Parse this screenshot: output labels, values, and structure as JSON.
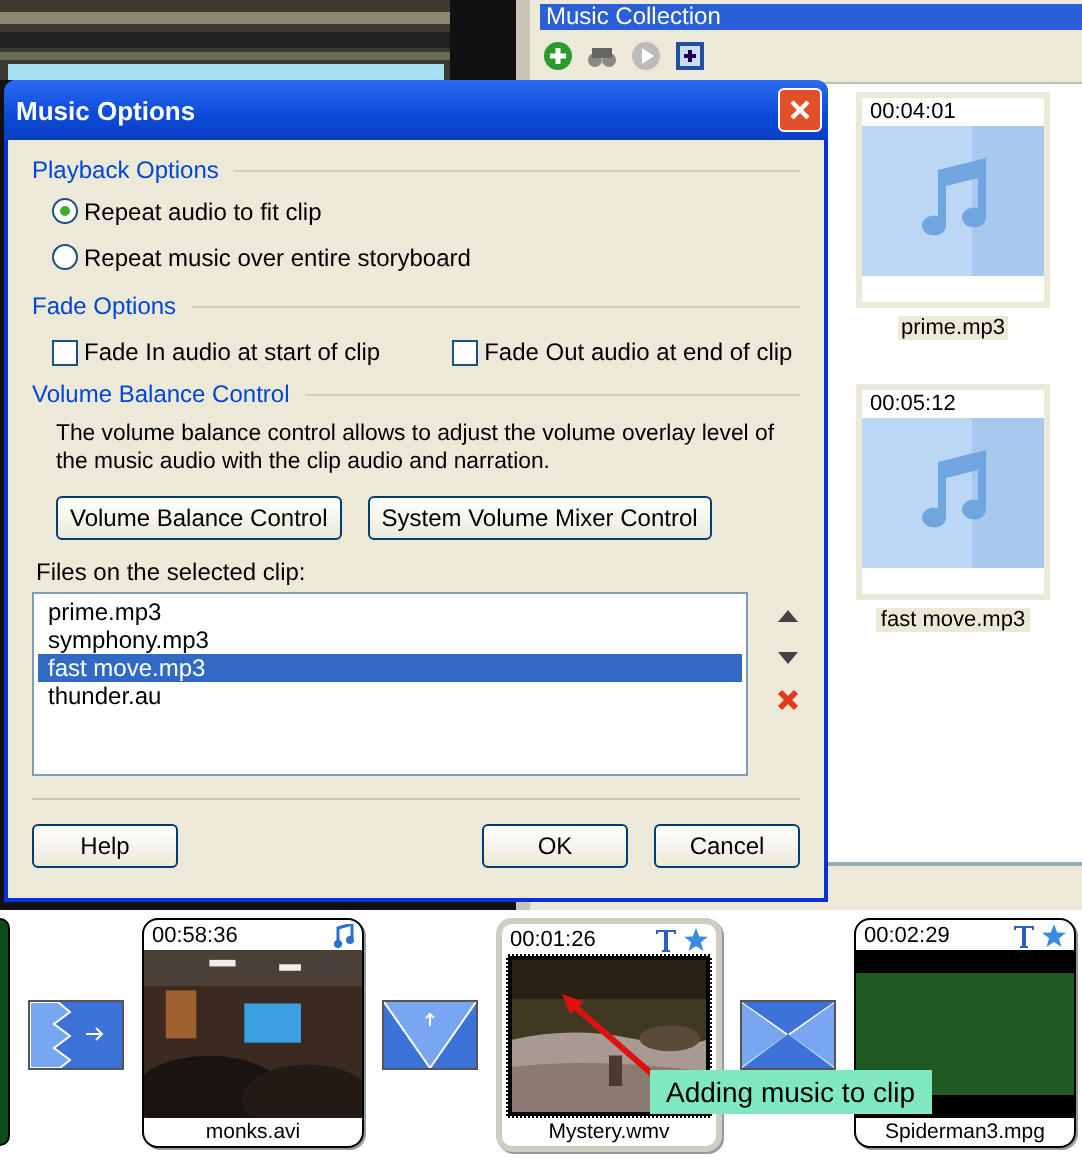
{
  "music_collection": {
    "title": "Music Collection",
    "items": [
      {
        "duration": "00:04:01",
        "name": "prime.mp3"
      },
      {
        "duration": "00:05:12",
        "name": "fast move.mp3"
      }
    ]
  },
  "dialog": {
    "title": "Music Options",
    "playback": {
      "heading": "Playback Options",
      "options": [
        {
          "label": "Repeat audio to fit clip",
          "selected": true
        },
        {
          "label": "Repeat music over entire storyboard",
          "selected": false
        }
      ]
    },
    "fade": {
      "heading": "Fade Options",
      "options": [
        {
          "label": "Fade In audio at start of clip",
          "checked": false
        },
        {
          "label": "Fade Out audio at end of clip",
          "checked": false
        }
      ]
    },
    "volume": {
      "heading": "Volume Balance Control",
      "description": "The volume balance control allows to adjust the volume overlay level of the music audio with the clip audio and narration.",
      "buttons": [
        "Volume Balance Control",
        "System Volume Mixer Control"
      ]
    },
    "files": {
      "label": "Files on the selected clip:",
      "items": [
        {
          "name": "prime.mp3",
          "selected": false
        },
        {
          "name": "symphony.mp3",
          "selected": false
        },
        {
          "name": "fast move.mp3",
          "selected": true
        },
        {
          "name": "thunder.au",
          "selected": false
        }
      ]
    },
    "buttons": {
      "help": "Help",
      "ok": "OK",
      "cancel": "Cancel"
    }
  },
  "storyboard": {
    "clips": [
      {
        "duration": "00:58:36",
        "name": "monks.avi",
        "selected": false,
        "music": true,
        "title": false,
        "effect": false
      },
      {
        "duration": "00:01:26",
        "name": "Mystery.wmv",
        "selected": true,
        "music": false,
        "title": true,
        "effect": true
      },
      {
        "duration": "00:02:29",
        "name": "Spiderman3.mpg",
        "selected": false,
        "music": false,
        "title": true,
        "effect": true
      }
    ],
    "callout": "Adding music to clip"
  }
}
